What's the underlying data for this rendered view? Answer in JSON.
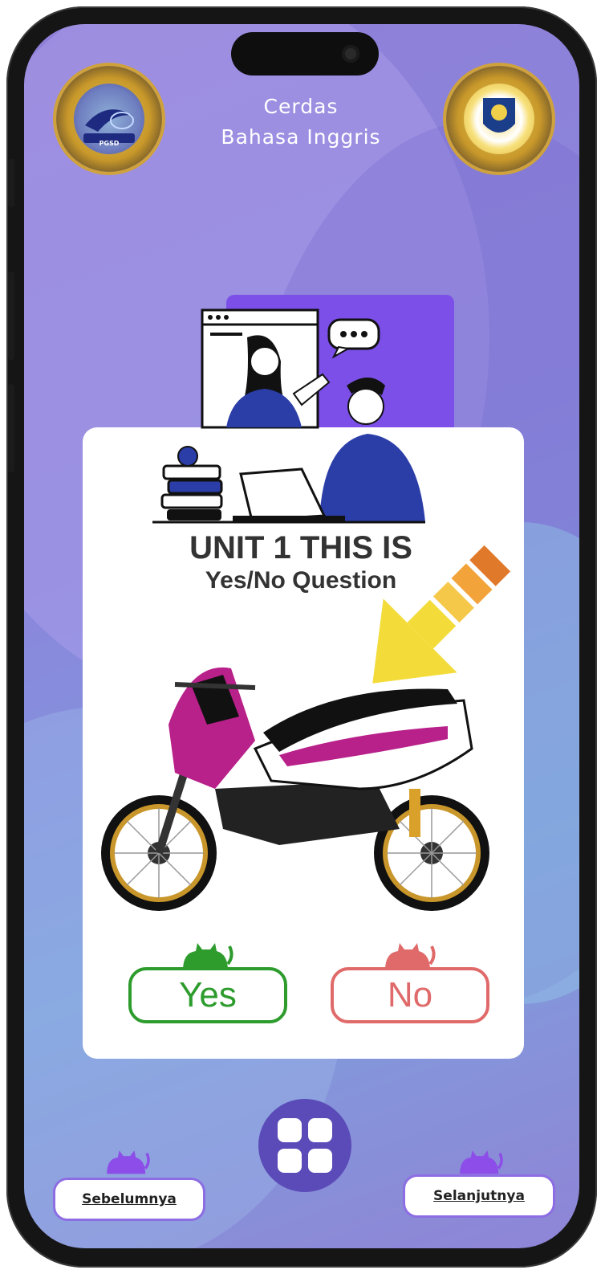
{
  "app": {
    "title_line1": "Cerdas",
    "title_line2": "Bahasa Inggris"
  },
  "logos": {
    "left_icon": "university-seal-icon",
    "left_text": "PGSD",
    "right_icon": "university-emblem-icon"
  },
  "lesson": {
    "unit_title": "UNIT 1 THIS IS",
    "subtitle": "Yes/No Question"
  },
  "answers": {
    "yes_label": "Yes",
    "no_label": "No"
  },
  "navigation": {
    "prev_label": "Sebelumnya",
    "next_label": "Selanjutnya",
    "menu_icon": "grid-menu-icon"
  },
  "colors": {
    "background": "#8a86dc",
    "card": "#ffffff",
    "yes": "#2d9c2d",
    "no": "#e06a6a",
    "accent_purple": "#7b4fe8",
    "menu_button": "#5b4bb8"
  }
}
